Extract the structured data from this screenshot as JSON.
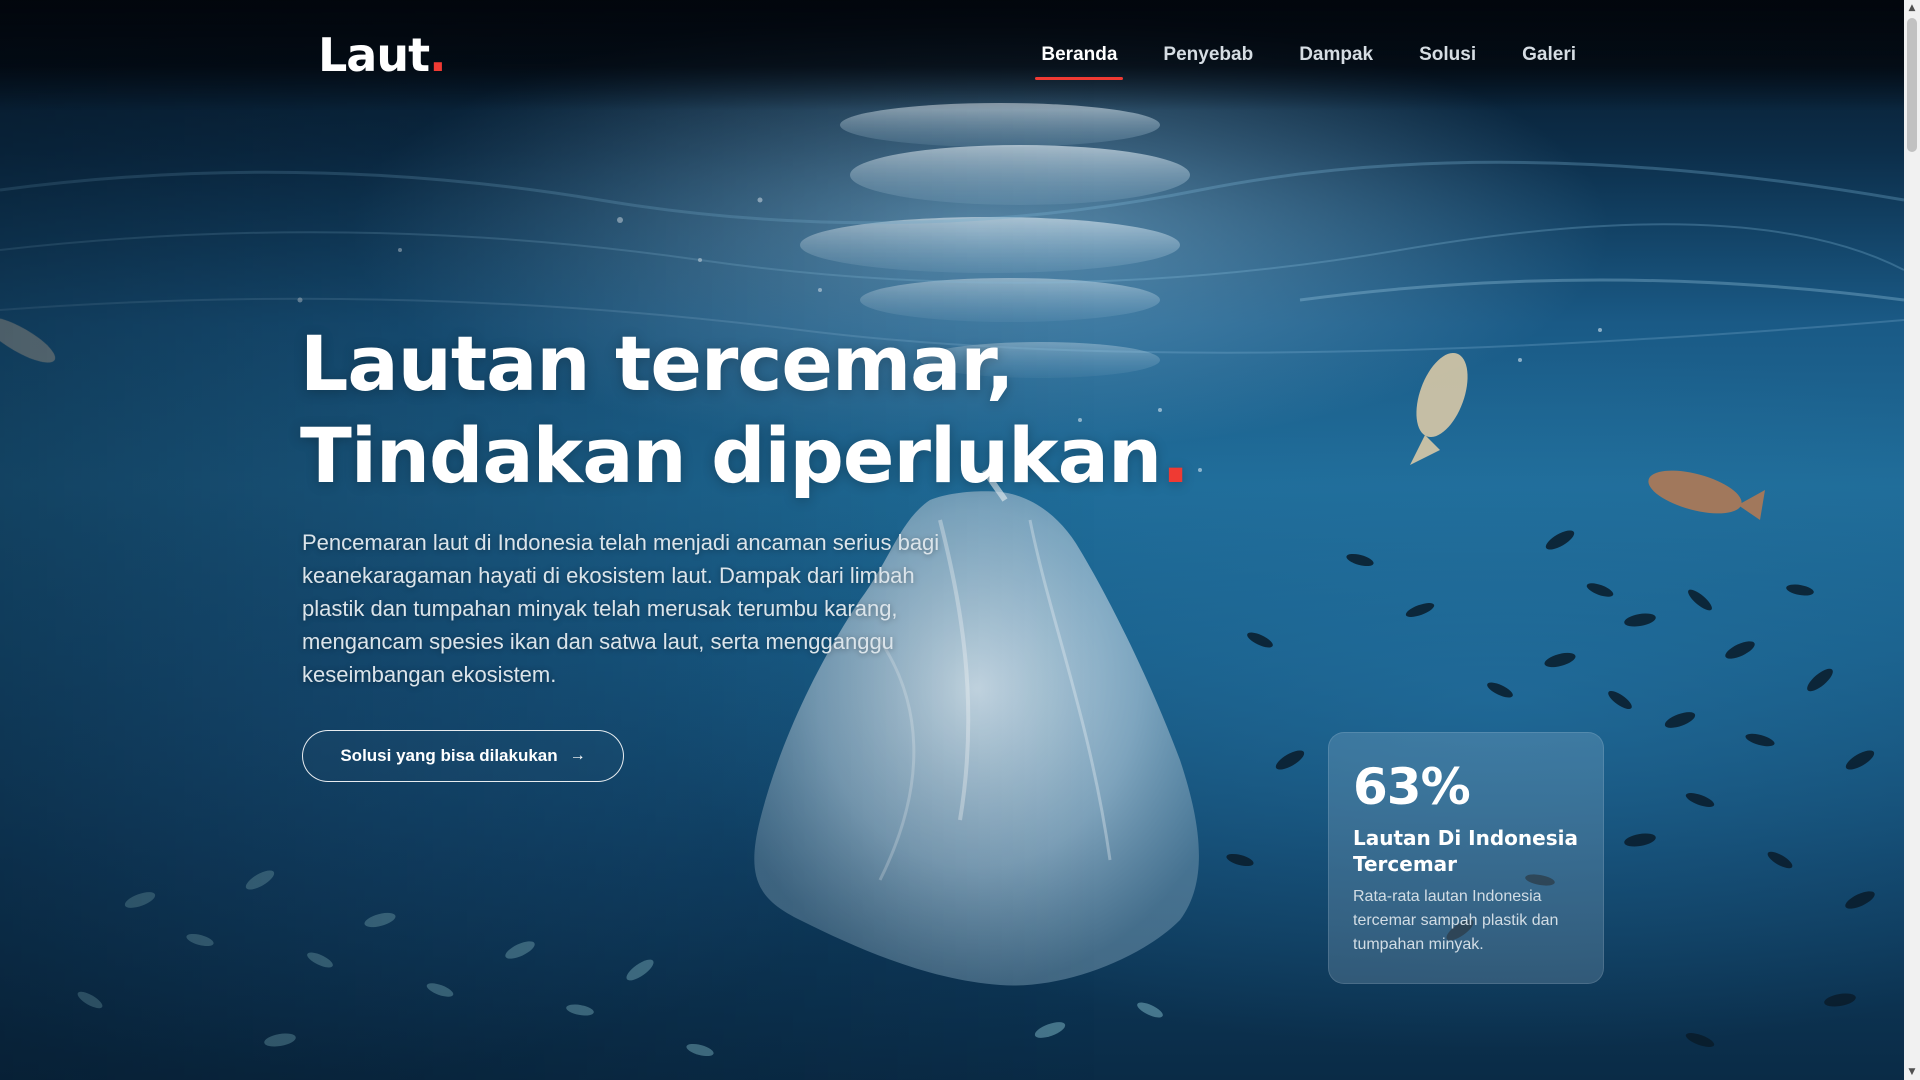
{
  "brand": {
    "name": "Laut",
    "dot": "."
  },
  "nav": {
    "items": [
      {
        "label": "Beranda",
        "active": true
      },
      {
        "label": "Penyebab",
        "active": false
      },
      {
        "label": "Dampak",
        "active": false
      },
      {
        "label": "Solusi",
        "active": false
      },
      {
        "label": "Galeri",
        "active": false
      }
    ]
  },
  "hero": {
    "title_line1": "Lautan tercemar,",
    "title_line2": "Tindakan diperlukan",
    "title_dot": ".",
    "description": "Pencemaran laut di Indonesia telah menjadi ancaman serius bagi keanekaragaman hayati di ekosistem laut. Dampak dari limbah plastik dan tumpahan minyak telah merusak terumbu karang, mengancam spesies ikan dan satwa laut, serta mengganggu keseimbangan ekosistem.",
    "cta_label": "Solusi yang bisa dilakukan",
    "cta_icon": "arrow-right-icon"
  },
  "stat": {
    "value": "63%",
    "title": "Lautan Di Indonesia Tercemar",
    "description": "Rata-rata lautan Indonesia tercemar sampah plastik dan tumpahan minyak."
  },
  "colors": {
    "accent": "#ef3a33",
    "text": "#ffffff",
    "ocean_dark": "#0a2b46",
    "ocean_mid": "#1f6c98"
  }
}
